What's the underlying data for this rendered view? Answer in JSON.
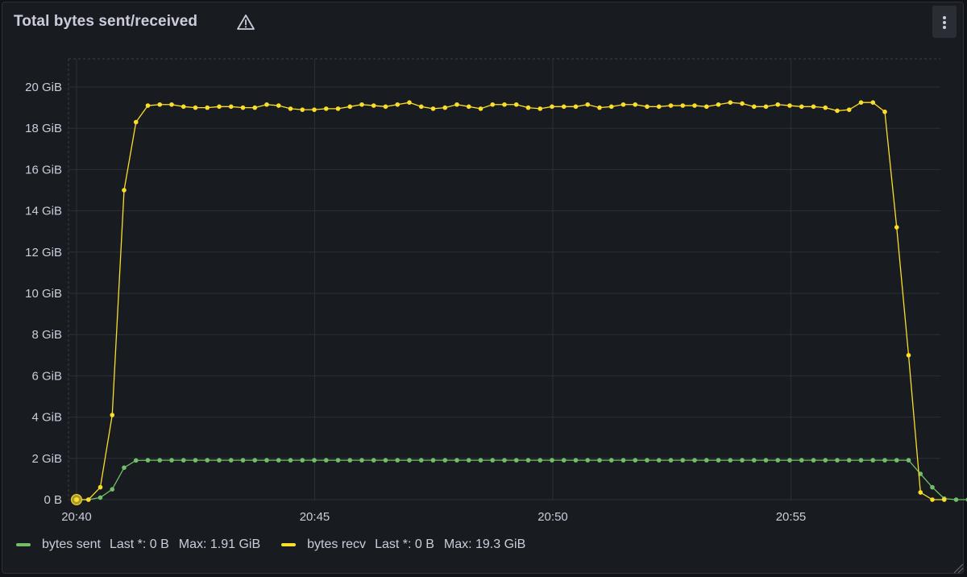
{
  "panel": {
    "title": "Total bytes sent/received",
    "warning_icon": "warning-triangle-icon",
    "menu_icon": "vertical-ellipsis-icon"
  },
  "colors": {
    "background": "#181b1f",
    "grid": "#2c2f36",
    "bytes_sent": "#73bf69",
    "bytes_recv": "#fade2a"
  },
  "legend": [
    {
      "name": "bytes sent",
      "last": "Last *: 0 B",
      "max": "Max: 1.91 GiB",
      "color": "#73bf69"
    },
    {
      "name": "bytes recv",
      "last": "Last *: 0 B",
      "max": "Max: 19.3 GiB",
      "color": "#fade2a"
    }
  ],
  "chart_data": {
    "type": "line",
    "y_unit": "GiB",
    "ylim": [
      0,
      20
    ],
    "y_ticks": [
      {
        "value": 0,
        "label": "0 B"
      },
      {
        "value": 2,
        "label": "2 GiB"
      },
      {
        "value": 4,
        "label": "4 GiB"
      },
      {
        "value": 6,
        "label": "6 GiB"
      },
      {
        "value": 8,
        "label": "8 GiB"
      },
      {
        "value": 10,
        "label": "10 GiB"
      },
      {
        "value": 12,
        "label": "12 GiB"
      },
      {
        "value": 14,
        "label": "14 GiB"
      },
      {
        "value": 16,
        "label": "16 GiB"
      },
      {
        "value": 18,
        "label": "18 GiB"
      },
      {
        "value": 20,
        "label": "20 GiB"
      }
    ],
    "x_ticks": [
      "20:40",
      "20:45",
      "20:50",
      "20:55"
    ],
    "x_start": "20:40",
    "x_interval_seconds": 15,
    "grid": true,
    "legend_position": "bottom",
    "series": [
      {
        "name": "bytes sent",
        "color": "#73bf69",
        "values": [
          0,
          0,
          0.1,
          0.5,
          1.55,
          1.9,
          1.91,
          1.91,
          1.91,
          1.91,
          1.91,
          1.91,
          1.91,
          1.91,
          1.91,
          1.91,
          1.91,
          1.91,
          1.91,
          1.91,
          1.91,
          1.91,
          1.91,
          1.91,
          1.91,
          1.91,
          1.91,
          1.91,
          1.91,
          1.91,
          1.91,
          1.91,
          1.91,
          1.91,
          1.91,
          1.91,
          1.91,
          1.91,
          1.91,
          1.91,
          1.91,
          1.91,
          1.91,
          1.91,
          1.91,
          1.91,
          1.91,
          1.91,
          1.91,
          1.91,
          1.91,
          1.91,
          1.91,
          1.91,
          1.91,
          1.91,
          1.91,
          1.91,
          1.91,
          1.91,
          1.91,
          1.91,
          1.91,
          1.91,
          1.91,
          1.91,
          1.91,
          1.91,
          1.91,
          1.91,
          1.91,
          1.25,
          0.6,
          0.05,
          0,
          0
        ]
      },
      {
        "name": "bytes recv",
        "color": "#fade2a",
        "values": [
          0,
          0,
          0.6,
          4.1,
          15,
          18.3,
          19.1,
          19.15,
          19.15,
          19.05,
          19,
          19,
          19.05,
          19.05,
          19,
          19,
          19.15,
          19.1,
          18.95,
          18.9,
          18.9,
          18.95,
          18.95,
          19.05,
          19.15,
          19.1,
          19.05,
          19.15,
          19.25,
          19.05,
          18.95,
          19,
          19.15,
          19.05,
          18.95,
          19.15,
          19.15,
          19.15,
          19,
          18.95,
          19.05,
          19.05,
          19.05,
          19.15,
          19,
          19.05,
          19.15,
          19.15,
          19.05,
          19.05,
          19.1,
          19.1,
          19.1,
          19.05,
          19.15,
          19.25,
          19.2,
          19.05,
          19.05,
          19.15,
          19.1,
          19.05,
          19.05,
          19,
          18.85,
          18.9,
          19.25,
          19.25,
          18.8,
          13.2,
          7,
          0.35,
          0,
          0
        ]
      }
    ]
  }
}
